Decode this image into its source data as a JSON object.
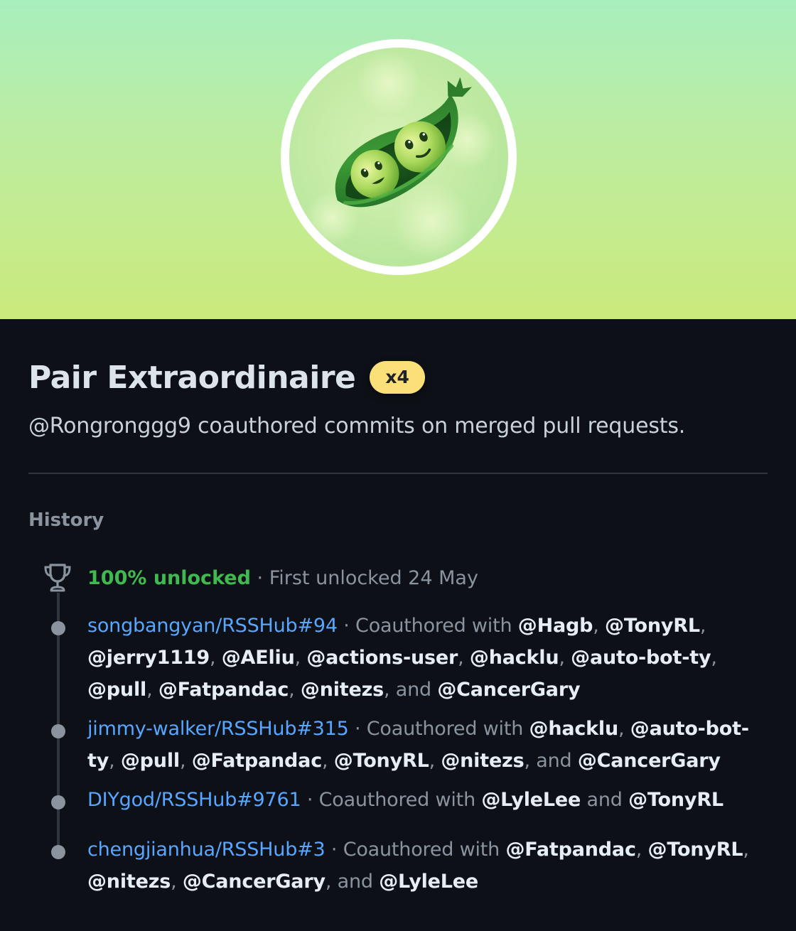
{
  "achievement": {
    "title": "Pair Extraordinaire",
    "tier": "x4",
    "description": "@Rongronggg9 coauthored commits on merged pull requests.",
    "badge_icon": "pea-pod-icon",
    "colors": {
      "banner_top": "#a8efbe",
      "banner_bottom": "#cbea7c",
      "tier_badge": "#fbe07a",
      "unlocked_green": "#3fb950",
      "link_blue": "#58a6ff"
    }
  },
  "history": {
    "label": "History",
    "unlock": {
      "percent": "100% unlocked",
      "separator": " · ",
      "first_unlocked": "First unlocked 24 May"
    },
    "entries": [
      {
        "repo": "songbangyan/RSSHub#94",
        "middle": " · Coauthored with ",
        "users": [
          "@Hagb",
          "@TonyRL",
          "@jerry1119",
          "@AEliu",
          "@actions-user",
          "@hacklu",
          "@auto-bot-ty",
          "@pull",
          "@Fatpandac",
          "@nitezs",
          "@CancerGary"
        ],
        "conj": "and"
      },
      {
        "repo": "jimmy-walker/RSSHub#315",
        "middle": " · Coauthored with ",
        "users": [
          "@hacklu",
          "@auto-bot-ty",
          "@pull",
          "@Fatpandac",
          "@TonyRL",
          "@nitezs",
          "@CancerGary"
        ],
        "conj": "and"
      },
      {
        "repo": "DIYgod/RSSHub#9761",
        "middle": " · Coauthored with ",
        "users": [
          "@LyleLee",
          "@TonyRL"
        ],
        "conj": "and"
      },
      {
        "repo": "chengjianhua/RSSHub#3",
        "middle": " · Coauthored with ",
        "users": [
          "@Fatpandac",
          "@TonyRL",
          "@nitezs",
          "@CancerGary",
          "@LyleLee"
        ],
        "conj": "and"
      }
    ]
  }
}
